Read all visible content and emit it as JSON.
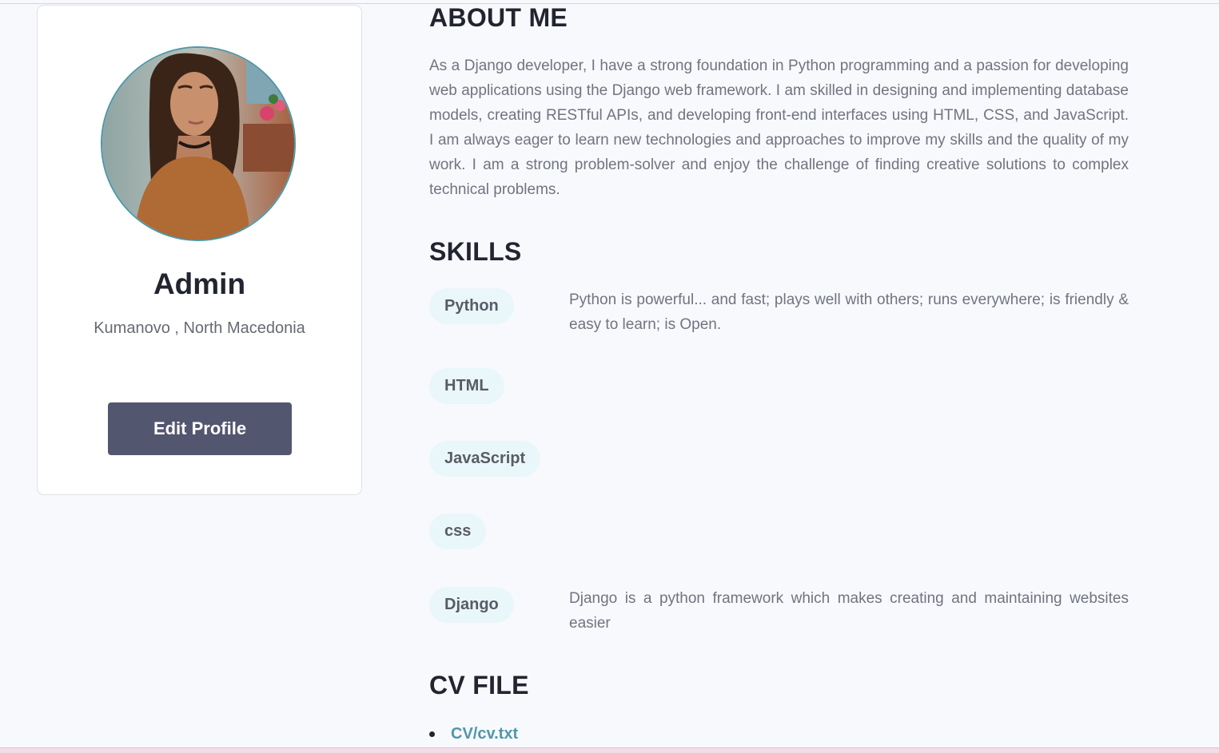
{
  "profile": {
    "name": "Admin",
    "location": "Kumanovo , North Macedonia",
    "edit_button_label": "Edit Profile"
  },
  "about": {
    "heading": "ABOUT ME",
    "text": "As a Django developer, I have a strong foundation in Python programming and a passion for developing web applications using the Django web framework. I am skilled in designing and implementing database models, creating RESTful APIs, and developing front-end interfaces using HTML, CSS, and JavaScript. I am always eager to learn new technologies and approaches to improve my skills and the quality of my work. I am a strong problem-solver and enjoy the challenge of finding creative solutions to complex technical problems."
  },
  "skills": {
    "heading": "SKILLS",
    "items": [
      {
        "name": "Python",
        "description": "Python is powerful... and fast; plays well with others; runs everywhere; is friendly & easy to learn; is Open."
      },
      {
        "name": "HTML",
        "description": ""
      },
      {
        "name": "JavaScript",
        "description": ""
      },
      {
        "name": "css",
        "description": ""
      },
      {
        "name": "Django",
        "description": "Django is a python framework which makes creating and maintaining websites easier"
      }
    ]
  },
  "cv": {
    "heading": "CV FILE",
    "files": [
      {
        "label": "CV/cv.txt"
      }
    ]
  },
  "colors": {
    "accent": "#4f97a8",
    "button": "#53566f",
    "pill_bg": "#e9f7fb",
    "heading": "#222430",
    "body_text": "#717480"
  }
}
